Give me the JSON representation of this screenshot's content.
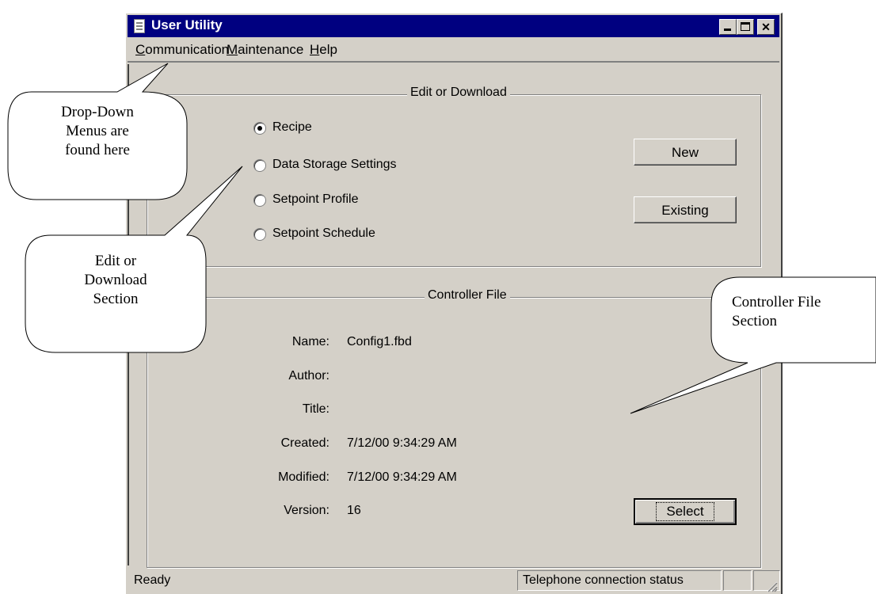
{
  "window": {
    "title": "User Utility"
  },
  "menu": [
    {
      "label_pre": "",
      "label_ul": "C",
      "label_post": "ommunication"
    },
    {
      "label_pre": "",
      "label_ul": "M",
      "label_post": "aintenance"
    },
    {
      "label_pre": "",
      "label_ul": "H",
      "label_post": "elp"
    }
  ],
  "edit_download": {
    "title": "Edit or Download",
    "options": [
      {
        "label": "Recipe",
        "checked": true
      },
      {
        "label": "Data Storage Settings",
        "checked": false
      },
      {
        "label": "Setpoint Profile",
        "checked": false
      },
      {
        "label": "Setpoint Schedule",
        "checked": false
      }
    ],
    "new_label": "New",
    "existing_label": "Existing"
  },
  "controller_file": {
    "title": "Controller File",
    "fields": [
      {
        "label": "Name:",
        "value": "Config1.fbd"
      },
      {
        "label": "Author:",
        "value": ""
      },
      {
        "label": "Title:",
        "value": ""
      },
      {
        "label": "Created:",
        "value": "7/12/00 9:34:29 AM"
      },
      {
        "label": "Modified:",
        "value": "7/12/00 9:34:29 AM"
      },
      {
        "label": "Version:",
        "value": "16"
      }
    ],
    "select_label": "Select"
  },
  "status": {
    "ready": "Ready",
    "telephone": "Telephone connection status"
  },
  "callouts": {
    "menus": [
      "Drop-Down",
      "Menus are",
      "found here"
    ],
    "edit": [
      "Edit or",
      "Download",
      "Section"
    ],
    "controller": [
      "Controller File",
      "Section"
    ]
  }
}
